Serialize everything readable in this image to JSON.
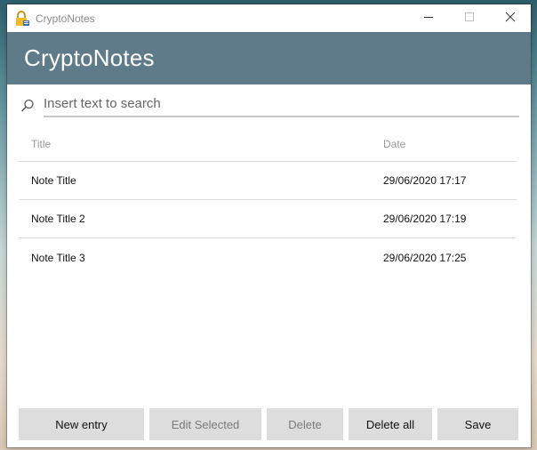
{
  "window": {
    "title": "CryptoNotes",
    "controls": {
      "minimize_icon": "minimize-icon",
      "maximize_icon": "maximize-icon",
      "close_icon": "close-icon"
    }
  },
  "header": {
    "title": "CryptoNotes",
    "background_color": "#5f7b89"
  },
  "search": {
    "placeholder": "Insert text to search",
    "value": "",
    "icon": "search-icon"
  },
  "notes_table": {
    "columns": [
      "Title",
      "Date"
    ],
    "rows": [
      {
        "title": "Note Title",
        "date": "29/06/2020 17:17"
      },
      {
        "title": "Note Title 2",
        "date": "29/06/2020 17:19"
      },
      {
        "title": "Note Title 3",
        "date": "29/06/2020 17:25"
      }
    ]
  },
  "buttons": {
    "new_entry": {
      "label": "New entry",
      "enabled": true
    },
    "edit_selected": {
      "label": "Edit Selected",
      "enabled": false
    },
    "delete": {
      "label": "Delete",
      "enabled": false
    },
    "delete_all": {
      "label": "Delete all",
      "enabled": true
    },
    "save": {
      "label": "Save",
      "enabled": true
    }
  }
}
